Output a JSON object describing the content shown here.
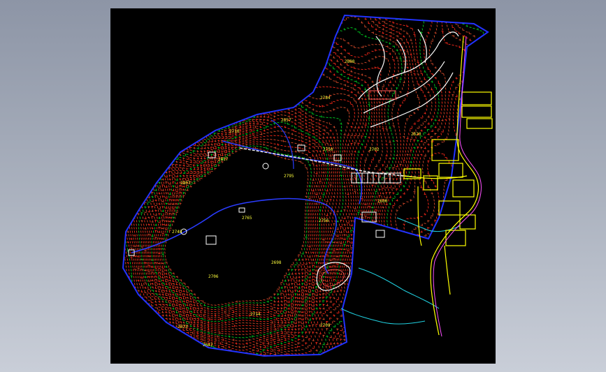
{
  "colors": {
    "background": "#000000",
    "boundary": "#2233ff",
    "contour_major": "#ff2a1a",
    "contour_minor": "#d84a2a",
    "contour_green": "#00d020",
    "road": "#ffff00",
    "water": "#20d0e0",
    "building": "#ffffff",
    "highway": "#ff50ff"
  },
  "elevation_labels": [
    {
      "text": "2808"
    },
    {
      "text": "2784"
    },
    {
      "text": "2857"
    },
    {
      "text": "2710"
    },
    {
      "text": "2807"
    },
    {
      "text": "2817"
    },
    {
      "text": "2795"
    },
    {
      "text": "2750"
    },
    {
      "text": "2765"
    },
    {
      "text": "2756"
    },
    {
      "text": "2748"
    },
    {
      "text": "2698"
    },
    {
      "text": "2706"
    },
    {
      "text": "2714"
    },
    {
      "text": "2709"
    },
    {
      "text": "2673"
    },
    {
      "text": "2642"
    },
    {
      "text": "2620"
    },
    {
      "text": "2600"
    },
    {
      "text": "2702"
    }
  ]
}
